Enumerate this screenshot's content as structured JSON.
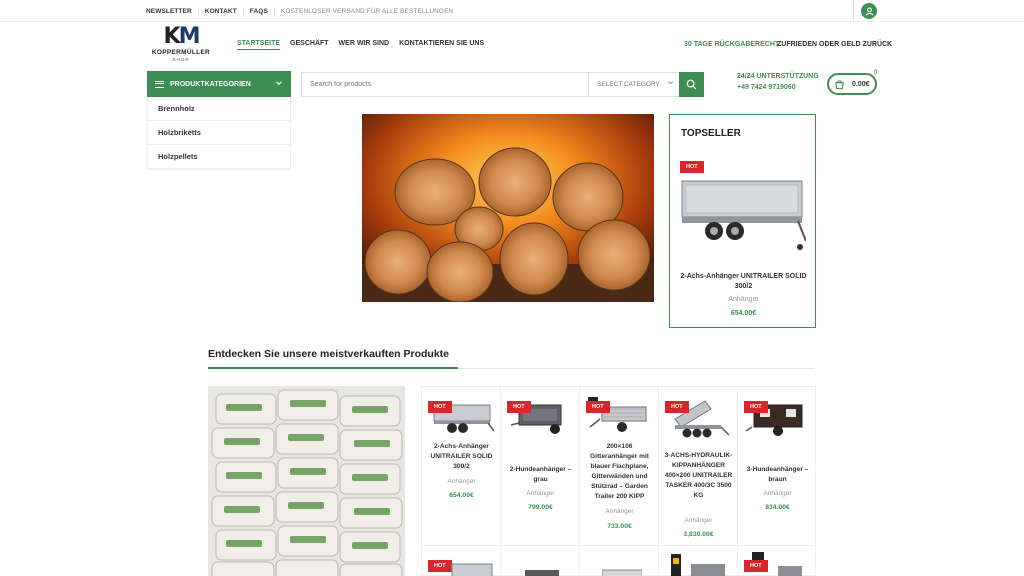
{
  "topbar": {
    "links": [
      "NEWSLETTER",
      "KONTAKT",
      "FAQS"
    ],
    "promo": "KOSTENLOSER VERSAND FÜR ALLE BESTELLUNGEN"
  },
  "logo": {
    "mark_k": "K",
    "mark_m": "M",
    "name": "KOPPERMÜLLER",
    "sub": "SHOP"
  },
  "nav": [
    "STARTSEITE",
    "GESCHÄFT",
    "WER WIR SIND",
    "KONTAKTIEREN SIE UNS"
  ],
  "guarantees": [
    "30 TAGE RÜCKGABERECHT",
    "ZUFRIEDEN ODER GELD ZURÜCK"
  ],
  "categories": {
    "button_label": "PRODUKTKATEGORIEN",
    "items": [
      "Brennholz",
      "Holzbriketts",
      "Holzpellets"
    ]
  },
  "search": {
    "placeholder": "Search for products",
    "category_select": "SELECT CATEGORY"
  },
  "support": {
    "title": "24/24 UNTERSTÜTZUNG",
    "phone": "+49 7424 9719060"
  },
  "cart": {
    "amount": "0.00€",
    "count": "0"
  },
  "topseller": {
    "heading": "TOPSELLER",
    "badge": "HOT",
    "name": "2-Achs-Anhänger UNITRAILER SOLID 300/2",
    "category": "Anhänger",
    "price": "654.00€"
  },
  "section_title": "Entdecken Sie unsere meistverkauften Produkte",
  "products": [
    {
      "badge": "HOT",
      "name": "2-Achs-Anhänger UNITRAILER SOLID 300/2",
      "category": "Anhänger",
      "price": "654.00€"
    },
    {
      "badge": "HOT",
      "name": "2-Hundeanhänger – grau",
      "category": "Anhänger",
      "price": "799.00€"
    },
    {
      "badge": "HOT",
      "name": "200×106 Gitteranhänger mit blauer Flachplane, Gitterwänden und Stützrad – Garden Trailer 200 KIPP",
      "category": "Anhänger",
      "price": "733.00€"
    },
    {
      "badge": "HOT",
      "name": "3-ACHS-HYDRAULIK-KIPPANHÄNGER 400×200 UNITRAILER TASKER 400/3C 3500 KG",
      "category": "Anhänger",
      "price": "3,830.00€"
    },
    {
      "badge": "HOT",
      "name": "3-Hundeanhänger – braun",
      "category": "Anhänger",
      "price": "834.00€"
    }
  ],
  "row2_badges": [
    "HOT",
    "HOT"
  ],
  "colors": {
    "accent": "#3e8e53",
    "hot": "#d9262b"
  }
}
